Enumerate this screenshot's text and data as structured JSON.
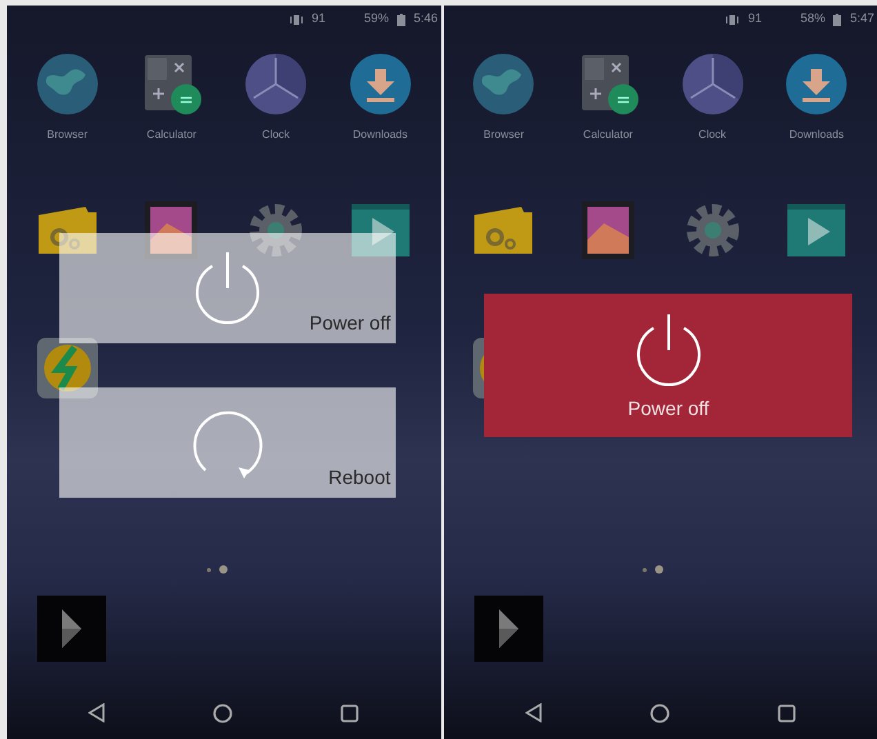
{
  "screens": [
    {
      "status_bar": {
        "volume": "91",
        "battery": "59%",
        "time": "5:46"
      },
      "apps": [
        {
          "kind": "browser",
          "label": "Browser"
        },
        {
          "kind": "calculator",
          "label": "Calculator"
        },
        {
          "kind": "clock",
          "label": "Clock"
        },
        {
          "kind": "downloads",
          "label": "Downloads"
        },
        {
          "kind": "files"
        },
        {
          "kind": "gallery"
        },
        {
          "kind": "settings"
        },
        {
          "kind": "video"
        },
        {
          "kind": "music"
        }
      ],
      "power_menu": [
        {
          "kind": "power",
          "label": "Power off",
          "selected": false
        },
        {
          "kind": "reboot",
          "label": "Reboot",
          "selected": false
        }
      ],
      "page_dots": [
        {
          "selected": false
        },
        {
          "selected": true
        }
      ]
    },
    {
      "status_bar": {
        "volume": "91",
        "battery": "58%",
        "time": "5:47"
      },
      "apps": [
        {
          "kind": "browser",
          "label": "Browser"
        },
        {
          "kind": "calculator",
          "label": "Calculator"
        },
        {
          "kind": "clock",
          "label": "Clock"
        },
        {
          "kind": "downloads",
          "label": "Downloads"
        },
        {
          "kind": "files"
        },
        {
          "kind": "gallery"
        },
        {
          "kind": "settings"
        },
        {
          "kind": "video"
        },
        {
          "kind": "music"
        }
      ],
      "power_menu": [
        {
          "kind": "power",
          "label": "Power off",
          "selected": true
        }
      ],
      "page_dots": [
        {
          "selected": false
        },
        {
          "selected": true
        }
      ]
    }
  ]
}
